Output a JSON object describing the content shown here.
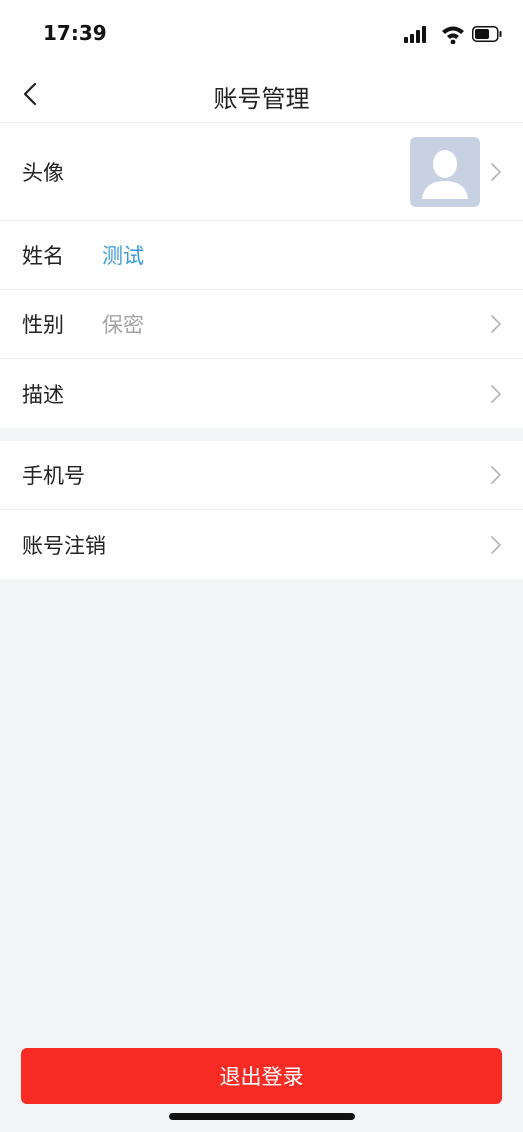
{
  "status_bar": {
    "time": "17:39",
    "icons": [
      "signal-icon",
      "wifi-icon",
      "battery-icon"
    ]
  },
  "nav": {
    "title": "账号管理",
    "back_icon": "chevron-left-icon"
  },
  "profile_group": [
    {
      "label": "头像",
      "value": "",
      "value_style": "none",
      "has_avatar": true,
      "has_arrow": true
    },
    {
      "label": "姓名",
      "value": "测试",
      "value_style": "blue",
      "has_avatar": false,
      "has_arrow": false
    },
    {
      "label": "性别",
      "value": "保密",
      "value_style": "gray",
      "has_avatar": false,
      "has_arrow": true
    },
    {
      "label": "描述",
      "value": "",
      "value_style": "none",
      "has_avatar": false,
      "has_arrow": true
    }
  ],
  "account_group": [
    {
      "label": "手机号",
      "has_arrow": true
    },
    {
      "label": "账号注销",
      "has_arrow": true
    }
  ],
  "logout_button": {
    "label": "退出登录"
  },
  "colors": {
    "accent_blue": "#3a9ad9",
    "logout_red": "#f92b25",
    "page_bg": "#f4f5f7",
    "value_gray": "#a4a4a4"
  }
}
